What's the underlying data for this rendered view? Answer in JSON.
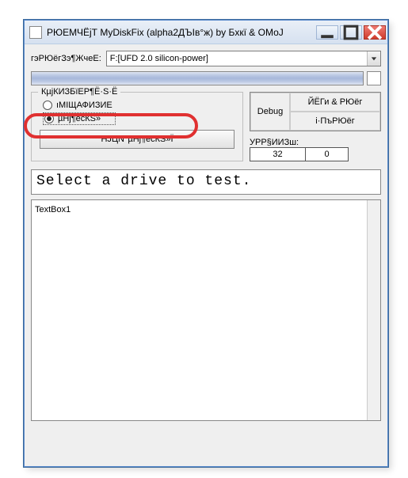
{
  "window": {
    "title": "РЮЕМЧЁјТ MyDiskFix (alpha2ДЪІв°ж) by Бхкї & ОМоЈ"
  },
  "driveLabel": "гэРЮёгЗэ¶ЖчеЕ:",
  "driveCombo": {
    "selected": "F:[UFD 2.0 silicon-power]"
  },
  "group": {
    "title": "КµјКИЗБїЕР¶Ё·Ѕ·Ё",
    "option1": "ıМІЩАФИЗИЕ",
    "option2_a": "µНј¶ёсКЅ»",
    "button": "НЈЦN°µНј¶ёсКЅ»Ї"
  },
  "rightPanel": {
    "debug": "Debug",
    "btn1": "ЙЁГи & РЮёг",
    "btn2": "і·ПъРЮёг"
  },
  "counts": {
    "label": "УРР§ИИЗш:",
    "val1": "32",
    "val2": "0"
  },
  "statusMessage": "Select a drive to test.",
  "textbox": "TextBox1"
}
